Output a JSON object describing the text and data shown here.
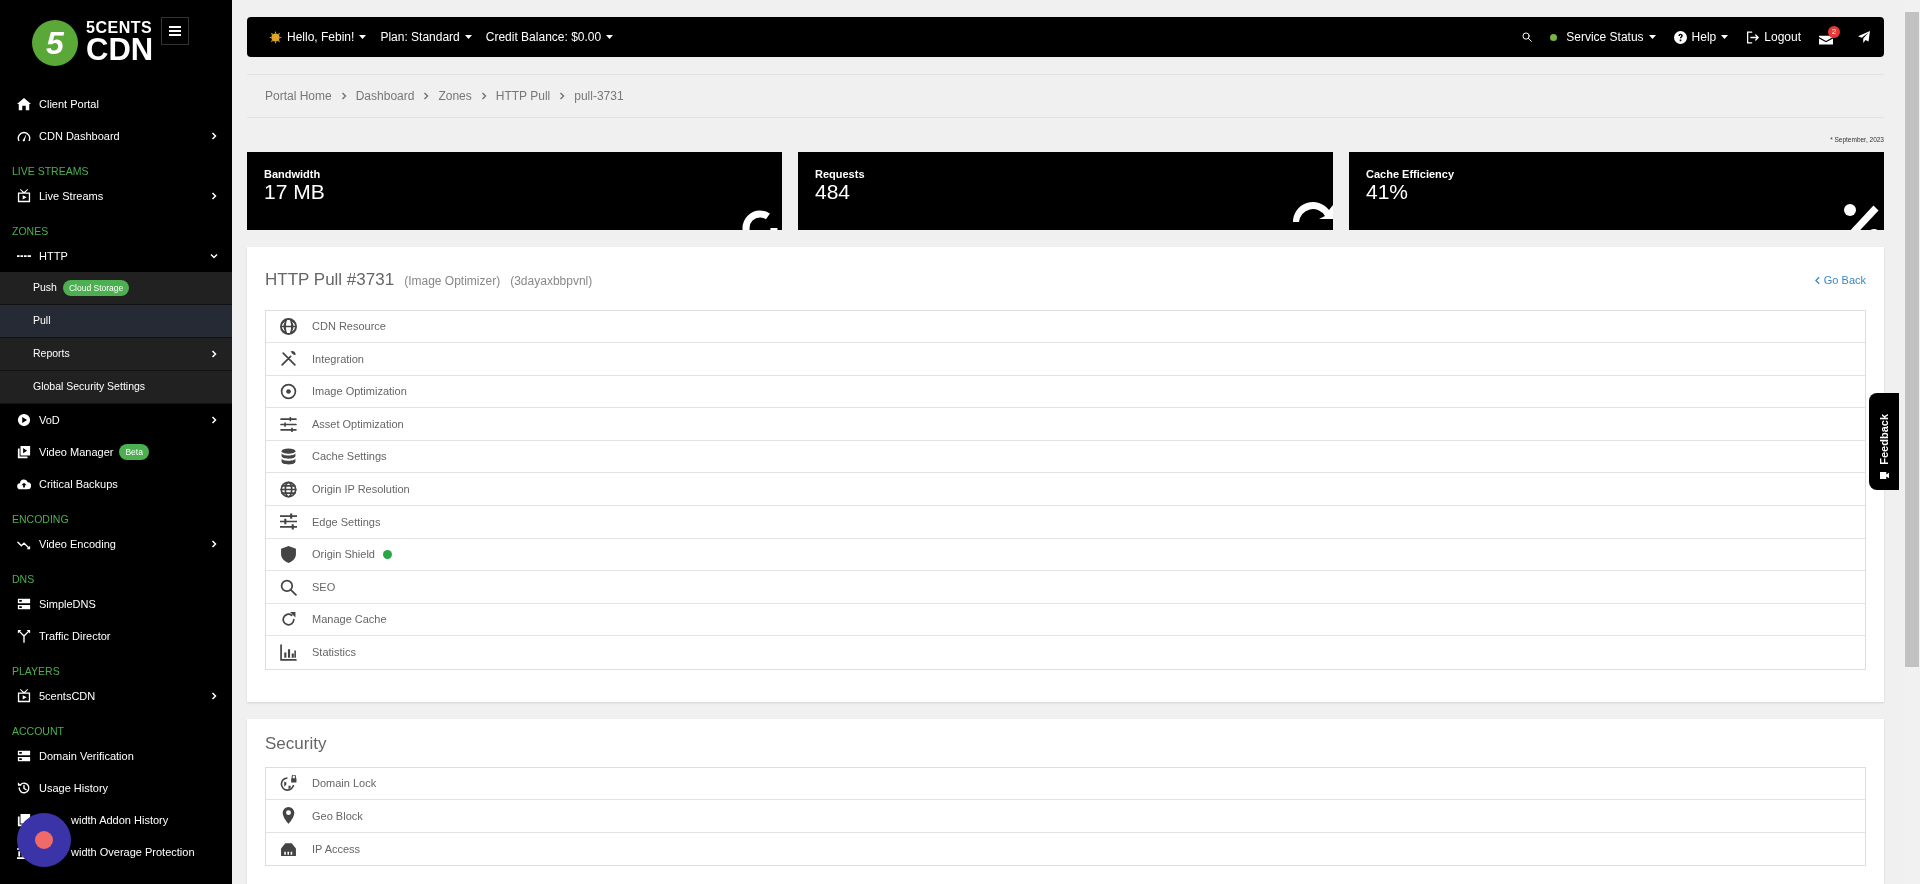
{
  "sidebar": {
    "logo": {
      "mark": "5",
      "line1": "5CENTS",
      "line2": "CDN"
    },
    "items": [
      {
        "kind": "link",
        "label": "Client Portal"
      },
      {
        "kind": "link",
        "label": "CDN Dashboard",
        "submenu": true,
        "expanded": false
      },
      {
        "kind": "section",
        "label": "LIVE STREAMS"
      },
      {
        "kind": "link",
        "label": "Live Streams",
        "submenu": true,
        "expanded": false
      },
      {
        "kind": "section",
        "label": "ZONES"
      },
      {
        "kind": "link",
        "label": "HTTP",
        "submenu": true,
        "expanded": true,
        "children": [
          {
            "label": "Push",
            "badge": "Cloud Storage",
            "selected": false
          },
          {
            "label": "Pull",
            "selected": true
          },
          {
            "label": "Reports",
            "submenu": true,
            "selected": false
          },
          {
            "label": "Global Security Settings",
            "selected": false
          }
        ]
      },
      {
        "kind": "link",
        "label": "VoD",
        "submenu": true,
        "expanded": false
      },
      {
        "kind": "link",
        "label": "Video Manager",
        "badge": "Beta"
      },
      {
        "kind": "link",
        "label": "Critical Backups"
      },
      {
        "kind": "section",
        "label": "ENCODING"
      },
      {
        "kind": "link",
        "label": "Video Encoding",
        "submenu": true,
        "expanded": false
      },
      {
        "kind": "section",
        "label": "DNS"
      },
      {
        "kind": "link",
        "label": "SimpleDNS"
      },
      {
        "kind": "link",
        "label": "Traffic Director"
      },
      {
        "kind": "section",
        "label": "PLAYERS"
      },
      {
        "kind": "link",
        "label": "5centsCDN",
        "submenu": true,
        "expanded": false
      },
      {
        "kind": "section",
        "label": "ACCOUNT"
      },
      {
        "kind": "link",
        "label": "Domain Verification"
      },
      {
        "kind": "link",
        "label": "Usage History"
      },
      {
        "kind": "link",
        "label": "width Addon History",
        "obscured": true
      },
      {
        "kind": "link",
        "label": "width Overage Protection",
        "obscured": true
      }
    ]
  },
  "topbar": {
    "greeting": "Hello, Febin!",
    "plan": "Plan: Standard",
    "credit": "Credit Balance: $0.00",
    "status": {
      "label": "Service Status",
      "color": "#7cb342"
    },
    "help": "Help",
    "logout": "Logout",
    "mail_count": "2"
  },
  "breadcrumbs": [
    "Portal Home",
    "Dashboard",
    "Zones",
    "HTTP Pull",
    "pull-3731"
  ],
  "period_note": "* September, 2023",
  "stats": [
    {
      "label": "Bandwidth",
      "value": "17 MB"
    },
    {
      "label": "Requests",
      "value": "484"
    },
    {
      "label": "Cache Efficiency",
      "value": "41%"
    }
  ],
  "zone": {
    "title": "HTTP Pull #3731",
    "tags": [
      "(Image Optimizer)",
      "(3dayaxbbpvnl)"
    ],
    "back": "Go Back",
    "items": [
      {
        "label": "CDN Resource"
      },
      {
        "label": "Integration"
      },
      {
        "label": "Image Optimization"
      },
      {
        "label": "Asset Optimization"
      },
      {
        "label": "Cache Settings"
      },
      {
        "label": "Origin IP Resolution"
      },
      {
        "label": "Edge Settings"
      },
      {
        "label": "Origin Shield",
        "color": "#28a745"
      },
      {
        "label": "SEO"
      },
      {
        "label": "Manage Cache"
      },
      {
        "label": "Statistics"
      }
    ]
  },
  "security": {
    "title": "Security",
    "items": [
      {
        "label": "Domain Lock"
      },
      {
        "label": "Geo Block"
      },
      {
        "label": "IP Access"
      }
    ]
  },
  "feedback": "Feedback"
}
